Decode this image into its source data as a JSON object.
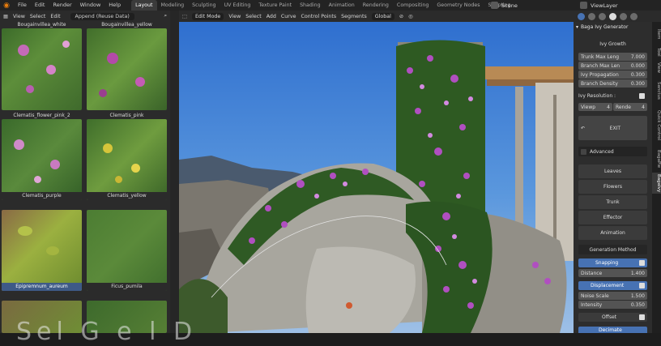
{
  "topbar": {
    "menus": [
      "File",
      "Edit",
      "Render",
      "Window",
      "Help"
    ],
    "workspaces": [
      "Layout",
      "Modeling",
      "Sculpting",
      "UV Editing",
      "Texture Paint",
      "Shading",
      "Animation",
      "Rendering",
      "Compositing",
      "Geometry Nodes",
      "Scripting"
    ],
    "active_workspace": "Layout",
    "scene": "Scene",
    "view_layer": "ViewLayer"
  },
  "asset_browser": {
    "menus": [
      "View",
      "Select",
      "Edit"
    ],
    "import_mode": "Append (Reuse Data)",
    "assets": [
      {
        "name": "Bougainvillea_white",
        "color": "#b85fb0"
      },
      {
        "name": "Bougainvillea_yellow",
        "color": "#b34aa8"
      },
      {
        "name": "Clematis_flower_pink_2",
        "color": "#c97ac0"
      },
      {
        "name": "Clematis_pink",
        "color": "#d08ac8"
      },
      {
        "name": "Clematis_purple",
        "color": "#9a4fb6"
      },
      {
        "name": "Clematis_yellow",
        "color": "#d6c53a"
      },
      {
        "name": "Epipremnum_aureum",
        "color": "#9bb040"
      },
      {
        "name": "Ficus_pumila",
        "color": "#5b8a3a"
      }
    ],
    "selected_asset": "Epipremnum_aureum"
  },
  "viewport_header": {
    "mode": "Edit Mode",
    "menus": [
      "View",
      "Select",
      "Add",
      "Curve",
      "Control Points",
      "Segments"
    ],
    "orientation": "Global"
  },
  "watermark": "Sel  G   e   l D",
  "ivy_panel": {
    "title": "Baga Ivy Generator",
    "section": "Ivy Growth",
    "params": [
      {
        "label": "Trunk Max Leng",
        "value": "7.000"
      },
      {
        "label": "Branch Max Len",
        "value": "0.000"
      },
      {
        "label": "Ivy Propagation",
        "value": "0.300"
      },
      {
        "label": "Branch Density",
        "value": "0.300"
      }
    ],
    "resolution_label": "Ivy Resolution :",
    "viewport_label": "Viewp",
    "viewport_value": "4",
    "render_label": "Rende",
    "render_value": "4",
    "exit_label": "EXIT",
    "advanced_label": "Advanced",
    "sections": [
      "Leaves",
      "Flowers",
      "Trunk",
      "Effector",
      "Animation"
    ],
    "generation_method_label": "Generation Method",
    "snapping_label": "Snapping",
    "distance_label": "Distance",
    "distance_value": "1.400",
    "displacement_label": "Displacement",
    "noise_scale_label": "Noise Scale",
    "noise_scale_value": "1.500",
    "intensity_label": "Intensity",
    "intensity_value": "0.350",
    "offset_label": "Offset",
    "decimate_label": "Decimate"
  },
  "side_tabs": [
    "Item",
    "Tool",
    "View",
    "Sanctus",
    "Quick Control",
    "BagaPie",
    "BagaIvy"
  ],
  "active_side_tab": "BagaIvy",
  "colors": {
    "accent_blue": "#4772b3",
    "blender_orange": "#e87d0d"
  }
}
